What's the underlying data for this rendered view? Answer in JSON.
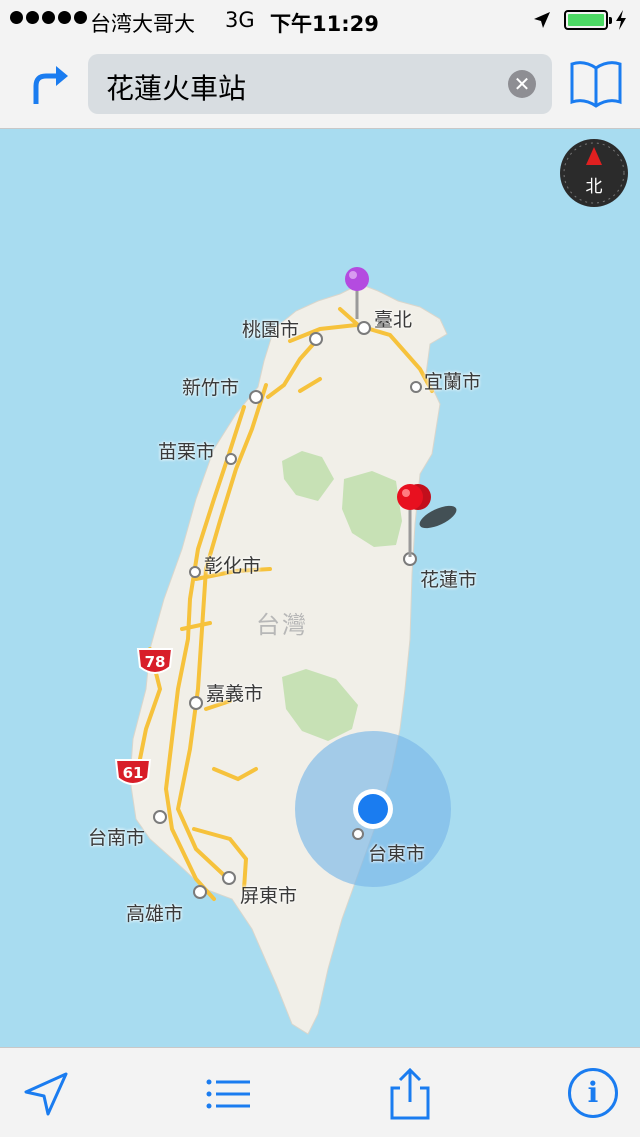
{
  "status_bar": {
    "carrier": "台湾大哥大",
    "network": "3G",
    "time": "下午11:29"
  },
  "search": {
    "query": "花蓮火車站",
    "clear_glyph": "✕"
  },
  "map": {
    "country_label": "台灣",
    "compass_label": "北",
    "labels": {
      "taipei": "臺北",
      "taoyuan": "桃園市",
      "hsinchu": "新竹市",
      "yilan": "宜蘭市",
      "miaoli": "苗栗市",
      "changhua": "彰化市",
      "hualien": "花蓮市",
      "chiayi": "嘉義市",
      "tainan": "台南市",
      "taitung": "台東市",
      "pingtung": "屏東市",
      "kaohsiung": "高雄市"
    },
    "route_shields": [
      "78",
      "61"
    ],
    "colors": {
      "water": "#a8dcf0",
      "land": "#f1efe8",
      "park": "#c7e1b5",
      "road": "#f6c23c",
      "accent": "#1a7cf0",
      "dropped_pin": "#b44be0",
      "search_pin": "#e8101f"
    }
  },
  "toolbar": {
    "items": [
      "location-arrow-icon",
      "list-icon",
      "share-icon",
      "info-icon"
    ],
    "info_glyph": "i"
  }
}
